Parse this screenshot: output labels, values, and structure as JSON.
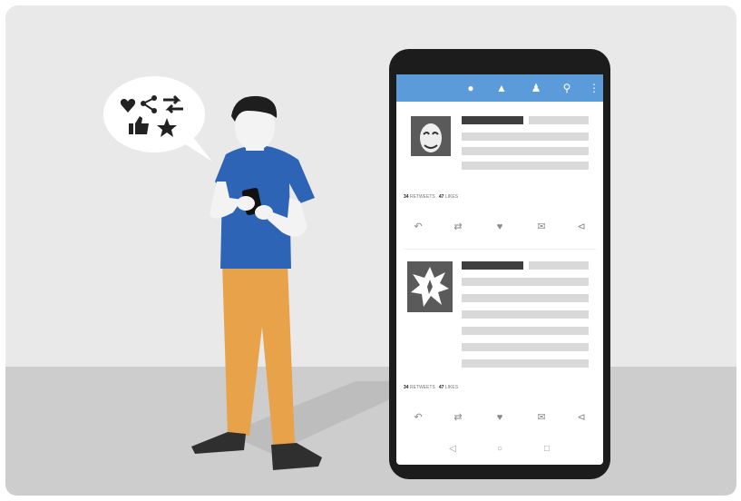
{
  "bubble": {
    "icons": [
      "heart-icon",
      "share-icon",
      "retweet-icon",
      "thumbs-up-icon",
      "star-icon"
    ]
  },
  "app_bar": {
    "color": "#5b9bd9",
    "icons": [
      "bell-icon",
      "car-icon",
      "add-user-icon",
      "search-icon",
      "more-icon"
    ]
  },
  "posts": [
    {
      "avatar_icon": "anonymous-mask-icon",
      "retweets_count": "34",
      "retweets_label": "RETWEETS",
      "likes_count": "47",
      "likes_label": "LIKES",
      "actions": [
        "reply-icon",
        "retweet-icon",
        "heart-icon",
        "message-icon",
        "share-icon"
      ]
    },
    {
      "avatar_icon": "explosion-icon",
      "retweets_count": "34",
      "retweets_label": "RETWEETS",
      "likes_count": "47",
      "likes_label": "LIKES",
      "actions": [
        "reply-icon",
        "retweet-icon",
        "heart-icon",
        "message-icon",
        "share-icon"
      ]
    }
  ],
  "nav_bar": {
    "icons": [
      "back-icon",
      "home-icon",
      "recents-icon"
    ]
  }
}
